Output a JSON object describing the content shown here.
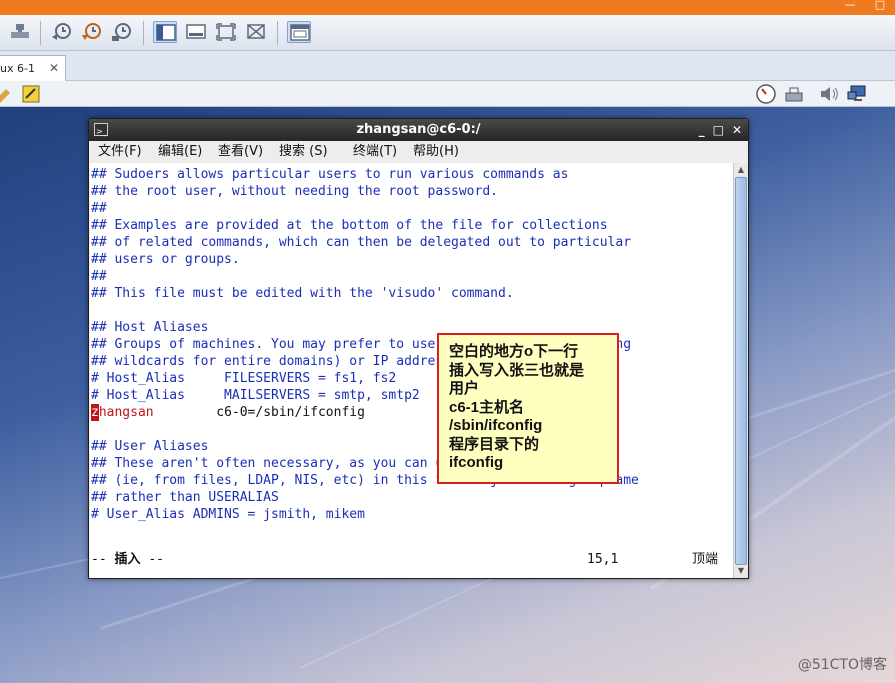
{
  "vmware": {
    "tab_label": "ux 6-1",
    "tab_close": "✕"
  },
  "terminal": {
    "title": "zhangsan@c6-0:/",
    "controls": [
      "_",
      "□",
      "✕"
    ],
    "menu": [
      "文件(F)",
      "编辑(E)",
      "查看(V)",
      "搜索 (S)",
      "终端(T)",
      "帮助(H)"
    ],
    "lines": [
      "## Sudoers allows particular users to run various commands as",
      "## the root user, without needing the root password.",
      "##",
      "## Examples are provided at the bottom of the file for collections",
      "## of related commands, which can then be delegated out to particular",
      "## users or groups.",
      "##",
      "## This file must be edited with the 'visudo' command.",
      "",
      "## Host Aliases",
      "## Groups of machines. You may prefer to use hostnames (perhaps using",
      "## wildcards for entire domains) or IP addresses instead.",
      "# Host_Alias     FILESERVERS = fs1, fs2",
      "# Host_Alias     MAILSERVERS = smtp, smtp2",
      "",
      "",
      "## User Aliases",
      "## These aren't often necessary, as you can use regular groups",
      "## (ie, from files, LDAP, NIS, etc) in this file - just use %groupname",
      "## rather than USERALIAS",
      "# User_Alias ADMINS = jsmith, mikem"
    ],
    "edit_line": {
      "cursor_char": "z",
      "user_rest": "hangsan",
      "spec": "        c6-0=/sbin/ifconfig"
    },
    "status": {
      "mode_prefix": "-- ",
      "mode": "插入",
      "mode_suffix": " --",
      "position": "15,1",
      "scroll": "顶端"
    }
  },
  "annotation": {
    "lines": [
      "空白的地方o下一行",
      "插入写入张三也就是",
      "用户",
      "c6-1主机名",
      "/sbin/ifconfig",
      "程序目录下的",
      "ifconfig"
    ]
  },
  "watermark": "@51CTO博客"
}
